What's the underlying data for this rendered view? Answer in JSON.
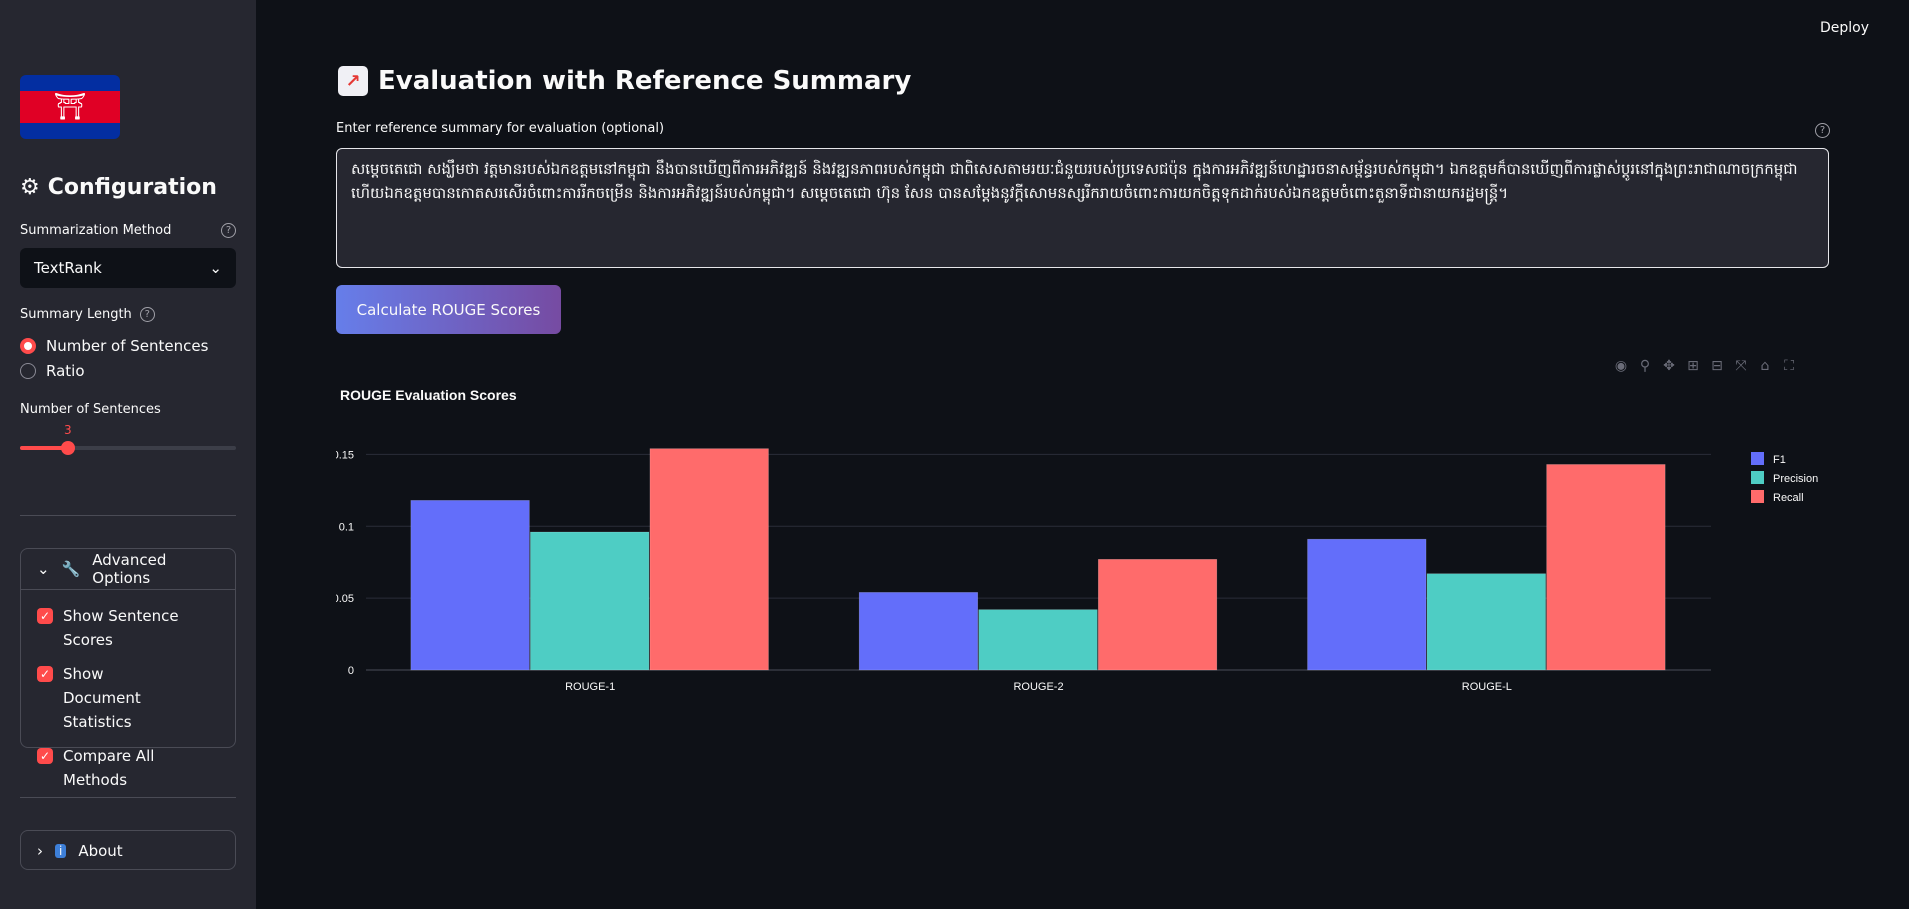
{
  "header": {
    "deploy_label": "Deploy"
  },
  "sidebar": {
    "title": "Configuration",
    "method_label": "Summarization Method",
    "method_value": "TextRank",
    "length_label": "Summary Length",
    "length_options": [
      "Number of Sentences",
      "Ratio"
    ],
    "sentences_label": "Number of Sentences",
    "sentences_value": "3",
    "sentences_fraction": 0.22,
    "advanced": {
      "label": "Advanced Options",
      "options": [
        "Show Sentence Scores",
        "Show Document Statistics",
        "Compare All Methods"
      ]
    },
    "about_label": "About"
  },
  "main": {
    "title": "Evaluation with Reference Summary",
    "reference_label": "Enter reference summary for evaluation (optional)",
    "reference_text": "សម្ដេចតេជោ សង្ឃឹមថា វត្តមានរបស់ឯកឧត្តមនៅកម្ពុជា នឹងបានឃើញពីការអភិវឌ្ឍន៍ និងវឌ្ឍនភាពរបស់កម្ពុជា ជាពិសេសតាមរយៈជំនួយរបស់ប្រទេសជប៉ុន ក្នុងការអភិវឌ្ឍន៍ហេដ្ឋារចនាសម្ព័ន្ធរបស់កម្ពុជា។ ឯកឧត្តមក៏បានឃើញពីការផ្លាស់ប្ដូរនៅក្នុងព្រះរាជាណាចក្រកម្ពុជា ហើយឯកឧត្តមបានកោតសរសើរចំពោះការរីកចម្រើន និងការអភិវឌ្ឍន៍របស់កម្ពុជា។ សម្ដេចតេជោ ហ៊ុន សែន បានសម្ដែងនូវក្ដីសោមនស្សរីករាយចំពោះការយកចិត្តទុកដាក់របស់ឯកឧត្តមចំពោះតួនាទីជានាយករដ្ឋមន្ត្រី។",
    "calc_button": "Calculate ROUGE Scores"
  },
  "chart_data": {
    "type": "bar",
    "title": "ROUGE Evaluation Scores",
    "categories": [
      "ROUGE-1",
      "ROUGE-2",
      "ROUGE-L"
    ],
    "series": [
      {
        "name": "F1",
        "values": [
          0.118,
          0.054,
          0.091
        ],
        "color": "#636efa"
      },
      {
        "name": "Precision",
        "values": [
          0.096,
          0.042,
          0.067
        ],
        "color": "#4ecdc4"
      },
      {
        "name": "Recall",
        "values": [
          0.154,
          0.077,
          0.143
        ],
        "color": "#ff6b6b"
      }
    ],
    "ylim": [
      0,
      0.16
    ],
    "yticks": [
      "0",
      "0.05",
      "0.1",
      "0.15"
    ],
    "ytick_values": [
      0,
      0.05,
      0.1,
      0.15
    ],
    "grid": true,
    "legend": "right"
  }
}
